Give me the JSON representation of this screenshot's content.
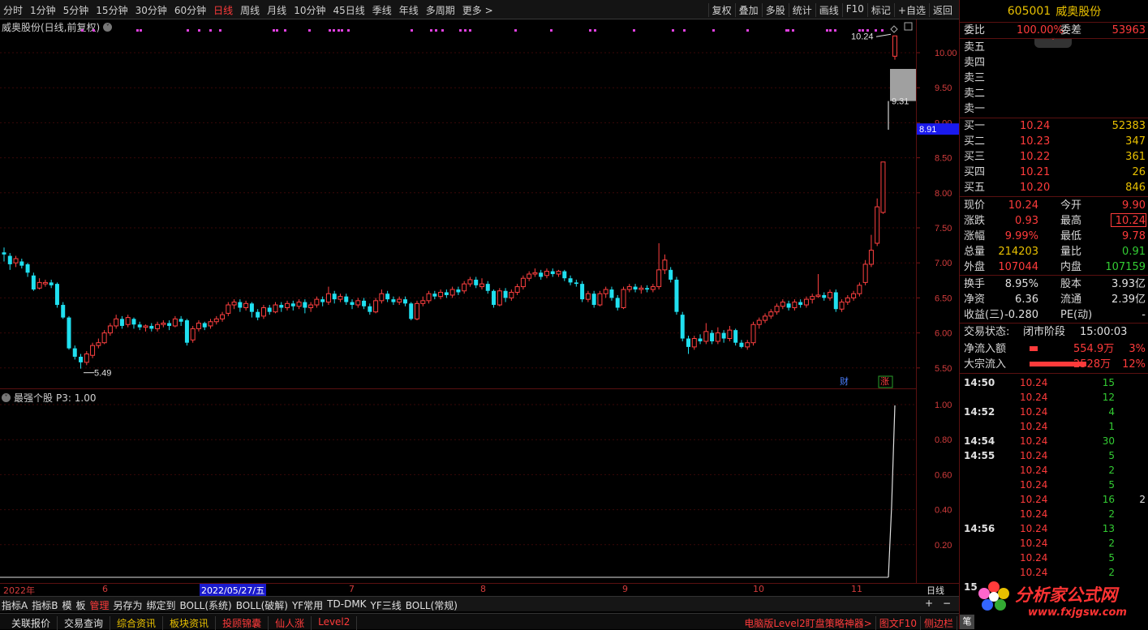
{
  "topbar": {
    "periods": [
      "分时",
      "1分钟",
      "5分钟",
      "15分钟",
      "30分钟",
      "60分钟",
      "日线",
      "周线",
      "月线",
      "10分钟",
      "45日线",
      "季线",
      "年线",
      "多周期",
      "更多 >"
    ],
    "active_period": "日线",
    "tools": [
      "复权",
      "叠加",
      "多股",
      "统计",
      "画线",
      "F10",
      "标记",
      "+自选",
      "返回"
    ]
  },
  "stock": {
    "code": "605001",
    "name": "威奥股份",
    "chart_title": "威奥股份(日线,前复权)"
  },
  "main_chart": {
    "y_ticks": [
      "10.00",
      "9.50",
      "9.00",
      "8.50",
      "8.00",
      "7.50",
      "7.00",
      "6.50",
      "6.00",
      "5.50"
    ],
    "current_price_tag": "8.91",
    "high_label": "10.24",
    "low_label": "5.49",
    "gap_label": "9.31",
    "markers": [
      "财",
      "涨"
    ]
  },
  "sub_chart": {
    "title": "最强个股",
    "param": "P3: 1.00",
    "y_ticks": [
      "1.00",
      "0.80",
      "0.60",
      "0.40",
      "0.20"
    ]
  },
  "date_axis": {
    "labels": [
      "2022年",
      "6",
      "7",
      "8",
      "9",
      "10",
      "11"
    ],
    "selected": "2022/05/27/五",
    "right": "日线"
  },
  "indicator_bar": [
    "指标A",
    "指标B",
    "模",
    "板",
    "管理",
    "另存为",
    "绑定到",
    "BOLL(系统)",
    "BOLL(破解)",
    "YF常用",
    "TD-DMK",
    "YF三线",
    "BOLL(常规)"
  ],
  "indicator_bar_red": "管理",
  "bottom_bar": {
    "tabs": [
      {
        "label": "关联报价",
        "color": "#e0e0e0"
      },
      {
        "label": "交易查询",
        "color": "#e0e0e0"
      },
      {
        "label": "综合资讯",
        "color": "#e8c000"
      },
      {
        "label": "板块资讯",
        "color": "#e8c000"
      },
      {
        "label": "投顾锦囊",
        "color": "#ff3b3b"
      },
      {
        "label": "仙人涨",
        "color": "#ff3b3b"
      },
      {
        "label": "Level2",
        "color": "#ff3b3b"
      }
    ],
    "right_links": [
      "电脑版Level2盯盘策略神器>",
      "图文F10",
      "侧边栏"
    ]
  },
  "quote": {
    "weibi_label": "委比",
    "weibi": "100.00%",
    "weicha_label": "委差",
    "weicha": "53963",
    "sells": [
      {
        "label": "卖五",
        "price": "",
        "vol": ""
      },
      {
        "label": "卖四",
        "price": "",
        "vol": ""
      },
      {
        "label": "卖三",
        "price": "",
        "vol": ""
      },
      {
        "label": "卖二",
        "price": "",
        "vol": ""
      },
      {
        "label": "卖一",
        "price": "",
        "vol": ""
      }
    ],
    "buys": [
      {
        "label": "买一",
        "price": "10.24",
        "vol": "52383"
      },
      {
        "label": "买二",
        "price": "10.23",
        "vol": "347"
      },
      {
        "label": "买三",
        "price": "10.22",
        "vol": "361"
      },
      {
        "label": "买四",
        "price": "10.21",
        "vol": "26"
      },
      {
        "label": "买五",
        "price": "10.20",
        "vol": "846"
      }
    ],
    "stats": [
      {
        "l1": "现价",
        "v1": "10.24",
        "c1": "red",
        "l2": "今开",
        "v2": "9.90",
        "c2": "red"
      },
      {
        "l1": "涨跌",
        "v1": "0.93",
        "c1": "red",
        "l2": "最高",
        "v2": "10.24",
        "c2": "red"
      },
      {
        "l1": "涨幅",
        "v1": "9.99%",
        "c1": "red",
        "l2": "最低",
        "v2": "9.78",
        "c2": "red"
      },
      {
        "l1": "总量",
        "v1": "214203",
        "c1": "yel",
        "l2": "量比",
        "v2": "0.91",
        "c2": "grn"
      },
      {
        "l1": "外盘",
        "v1": "107044",
        "c1": "red",
        "l2": "内盘",
        "v2": "107159",
        "c2": "grn"
      }
    ],
    "stats2": [
      {
        "l1": "换手",
        "v1": "8.95%",
        "l2": "股本",
        "v2": "3.93亿"
      },
      {
        "l1": "净资",
        "v1": "6.36",
        "l2": "流通",
        "v2": "2.39亿"
      },
      {
        "l1": "收益(三)",
        "v1": "-0.280",
        "l2": "PE(动)",
        "v2": "-"
      }
    ],
    "status_label": "交易状态:",
    "status": "闭市阶段",
    "status_time": "15:00:03",
    "netflow_label": "净流入额",
    "netflow": "554.9万",
    "netflow_pct": "3%",
    "bigflow_label": "大宗流入",
    "bigflow": "2528万",
    "bigflow_pct": "12%"
  },
  "ticks": [
    {
      "t": "14:50",
      "p": "10.24",
      "v": "15",
      "n": ""
    },
    {
      "t": "",
      "p": "10.24",
      "v": "12",
      "n": ""
    },
    {
      "t": "14:52",
      "p": "10.24",
      "v": "4",
      "n": ""
    },
    {
      "t": "",
      "p": "10.24",
      "v": "1",
      "n": ""
    },
    {
      "t": "14:54",
      "p": "10.24",
      "v": "30",
      "n": ""
    },
    {
      "t": "14:55",
      "p": "10.24",
      "v": "5",
      "n": ""
    },
    {
      "t": "",
      "p": "10.24",
      "v": "2",
      "n": ""
    },
    {
      "t": "",
      "p": "10.24",
      "v": "5",
      "n": ""
    },
    {
      "t": "",
      "p": "10.24",
      "v": "16",
      "n": "2"
    },
    {
      "t": "",
      "p": "10.24",
      "v": "2",
      "n": ""
    },
    {
      "t": "14:56",
      "p": "10.24",
      "v": "13",
      "n": ""
    },
    {
      "t": "",
      "p": "10.24",
      "v": "2",
      "n": ""
    },
    {
      "t": "",
      "p": "10.24",
      "v": "5",
      "n": ""
    },
    {
      "t": "",
      "p": "10.24",
      "v": "2",
      "n": ""
    },
    {
      "t": "15",
      "p": "",
      "v": "",
      "n": ""
    }
  ],
  "logo": {
    "text": "分析家公式网",
    "url_text": "www.fxjgsw.com"
  }
}
